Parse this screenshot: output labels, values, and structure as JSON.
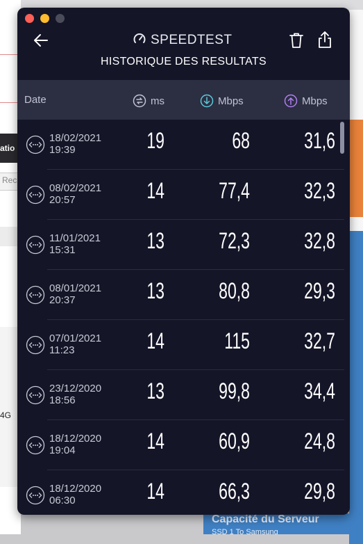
{
  "background": {
    "left_snippets": [
      "atio",
      "Rec",
      "4G"
    ],
    "bottom_right": [
      "Capacité du Serveur",
      "SSD 1 To Samsung"
    ]
  },
  "app": {
    "brand": "SPEEDTEST",
    "title": "HISTORIQUE DES RESULTATS"
  },
  "columns": {
    "date": "Date",
    "ping": "ms",
    "download": "Mbps",
    "upload": "Mbps"
  },
  "colors": {
    "download_accent": "#5cc9d8",
    "upload_accent": "#b07ff0"
  },
  "results": [
    {
      "date": "18/02/2021",
      "time": "19:39",
      "ping": "19",
      "download": "68",
      "upload": "31,6"
    },
    {
      "date": "08/02/2021",
      "time": "20:57",
      "ping": "14",
      "download": "77,4",
      "upload": "32,3"
    },
    {
      "date": "11/01/2021",
      "time": "15:31",
      "ping": "13",
      "download": "72,3",
      "upload": "32,8"
    },
    {
      "date": "08/01/2021",
      "time": "20:37",
      "ping": "13",
      "download": "80,8",
      "upload": "29,3"
    },
    {
      "date": "07/01/2021",
      "time": "11:23",
      "ping": "14",
      "download": "115",
      "upload": "32,7"
    },
    {
      "date": "23/12/2020",
      "time": "18:56",
      "ping": "13",
      "download": "99,8",
      "upload": "34,4"
    },
    {
      "date": "18/12/2020",
      "time": "19:04",
      "ping": "14",
      "download": "60,9",
      "upload": "24,8"
    },
    {
      "date": "18/12/2020",
      "time": "06:30",
      "ping": "14",
      "download": "66,3",
      "upload": "29,8"
    }
  ]
}
